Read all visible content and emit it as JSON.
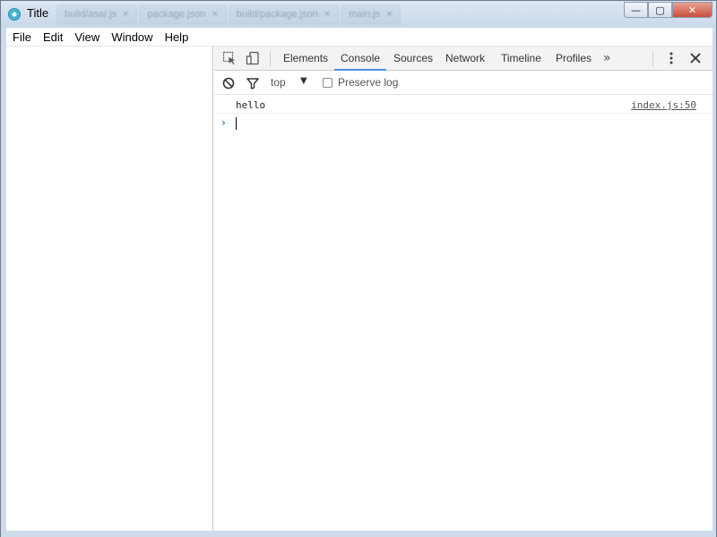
{
  "window": {
    "title": "Title",
    "background_tabs": [
      {
        "label": "build/asar.js"
      },
      {
        "label": "package.json"
      },
      {
        "label": "build/package.json"
      },
      {
        "label": "main.js"
      }
    ],
    "controls": {
      "minimize": "—",
      "maximize": "▢",
      "close": "✕"
    }
  },
  "menubar": {
    "items": [
      "File",
      "Edit",
      "View",
      "Window",
      "Help"
    ]
  },
  "devtools": {
    "tabs": [
      "Elements",
      "Console",
      "Sources",
      "Network",
      "Timeline",
      "Profiles"
    ],
    "active_tab": "Console",
    "more": "»",
    "console_toolbar": {
      "context": "top",
      "preserve_log_label": "Preserve log",
      "preserve_log_checked": false
    },
    "console": {
      "messages": [
        {
          "text": "hello",
          "source": "index.js:50"
        }
      ],
      "prompt_symbol": "›",
      "input_value": ""
    }
  },
  "colors": {
    "accent": "#4d8ee8",
    "prompt": "#3c8ad8",
    "close_button": "#c7503c"
  }
}
